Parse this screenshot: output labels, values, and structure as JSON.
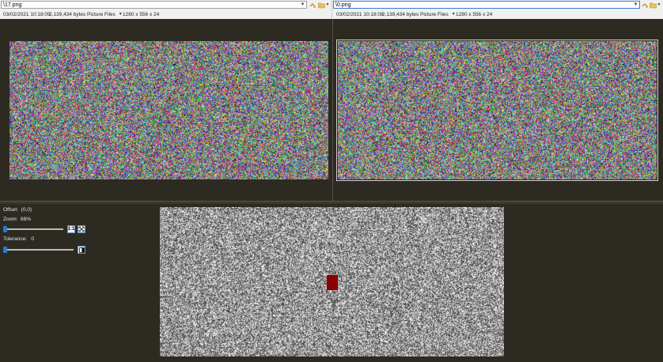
{
  "left_pane": {
    "path": "\\17.png",
    "info": {
      "date": "03/02/2021 10:18:09",
      "size": "2,139,434 bytes",
      "file_type": "Picture Files",
      "dimensions": "1280 x 556 x 24"
    }
  },
  "right_pane": {
    "path": "\\0.png",
    "info": {
      "date": "03/02/2021 10:18:08",
      "size": "2,139,434 bytes",
      "file_type": "Picture Files",
      "dimensions": "1280 x 556 x 24"
    }
  },
  "controls": {
    "offset_label": "Offset:",
    "offset_value": "(0,0)",
    "zoom_label": "Zoom:",
    "zoom_value": "68%",
    "zoom_slider_fraction": 0.0,
    "one_to_one_label": "1:1",
    "tolerance_label": "Tolerance:",
    "tolerance_value": "0",
    "tolerance_slider_fraction": 0.0
  },
  "colors": {
    "background": "#2d2b21",
    "diff_marker": "#8b0000",
    "accent": "#2a78d6"
  }
}
